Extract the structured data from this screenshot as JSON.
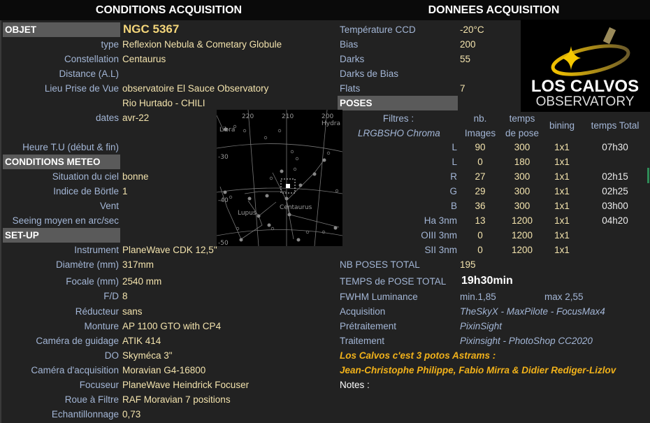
{
  "headers": {
    "left": "CONDITIONS ACQUISITION",
    "right": "DONNEES ACQUISITION"
  },
  "sections": {
    "objet": "OBJET",
    "meteo": "CONDITIONS METEO",
    "setup": "SET-UP",
    "poses": "POSES"
  },
  "object_name": "NGC 5367",
  "left_rows": [
    {
      "label": "type",
      "value": "Reflexion Nebula & Cometary Globule"
    },
    {
      "label": "Constellation",
      "value": "Centaurus"
    },
    {
      "label": "Distance (A.L)",
      "value": ""
    },
    {
      "label": "Lieu Prise de Vue",
      "value": "observatoire El Sauce Observatory"
    },
    {
      "label": "",
      "value": "Rio Hurtado - CHILI"
    },
    {
      "label": "dates",
      "value": "avr-22"
    },
    {
      "label": "Heure T.U (début & fin)",
      "value": ""
    },
    {
      "label": "Situation du ciel",
      "value": "bonne"
    },
    {
      "label": "Indice de Börtle",
      "value": "1"
    },
    {
      "label": "Vent",
      "value": ""
    },
    {
      "label": "Seeing moyen en arc/sec",
      "value": ""
    },
    {
      "label": "Instrument",
      "value": "PlaneWave CDK 12,5\""
    },
    {
      "label": "Diamètre (mm)",
      "value": "317mm"
    },
    {
      "label": "Focale (mm)",
      "value": "2540 mm"
    },
    {
      "label": "F/D",
      "value": "8"
    },
    {
      "label": "Réducteur",
      "value": "sans"
    },
    {
      "label": "Monture",
      "value": "AP 1100 GTO with CP4"
    },
    {
      "label": "Caméra de guidage",
      "value": "ATIK 414"
    },
    {
      "label": "DO",
      "value": "Skyméca 3\""
    },
    {
      "label": "Caméra d'acquisition",
      "value": "Moravian G4-16800"
    },
    {
      "label": "Focuseur",
      "value": "PlaneWave Heindrick Focuser"
    },
    {
      "label": "Roue à Filtre",
      "value": "RAF Moravian 7 positions"
    },
    {
      "label": "Echantillonnage",
      "value": "0,73"
    }
  ],
  "right_top": [
    {
      "label": "Température CCD",
      "value": "-20°C"
    },
    {
      "label": "Bias",
      "value": "200"
    },
    {
      "label": "Darks",
      "value": "55"
    },
    {
      "label": "Darks de Bias",
      "value": ""
    },
    {
      "label": "Flats",
      "value": "7"
    }
  ],
  "poses_table": {
    "filters_label": "Filtres :",
    "filters_name": "LRGBSHO Chroma",
    "col_nb": [
      "nb.",
      "Images"
    ],
    "col_temps": [
      "temps",
      "de pose"
    ],
    "col_bining": "bining",
    "col_total": "temps Total",
    "rows": [
      {
        "filter": "L",
        "nb": "90",
        "pose": "300",
        "bin": "1x1",
        "total": "07h30"
      },
      {
        "filter": "L",
        "nb": "0",
        "pose": "180",
        "bin": "1x1",
        "total": ""
      },
      {
        "filter": "R",
        "nb": "27",
        "pose": "300",
        "bin": "1x1",
        "total": "02h15"
      },
      {
        "filter": "G",
        "nb": "29",
        "pose": "300",
        "bin": "1x1",
        "total": "02h25"
      },
      {
        "filter": "B",
        "nb": "36",
        "pose": "300",
        "bin": "1x1",
        "total": "03h00"
      },
      {
        "filter": "Ha 3nm",
        "nb": "13",
        "pose": "1200",
        "bin": "1x1",
        "total": "04h20"
      },
      {
        "filter": "OIII 3nm",
        "nb": "0",
        "pose": "1200",
        "bin": "1x1",
        "total": ""
      },
      {
        "filter": "SII 3nm",
        "nb": "0",
        "pose": "1200",
        "bin": "1x1",
        "total": ""
      }
    ]
  },
  "totals": {
    "nb_label": "NB POSES TOTAL",
    "nb_value": "195",
    "temps_label": "TEMPS de POSE TOTAL",
    "temps_value": "19h30min",
    "fwhm_label": "FWHM Luminance",
    "fwhm_min": "min.1,85",
    "fwhm_max": "max 2,55"
  },
  "software": [
    {
      "label": "Acquisition",
      "value": "TheSkyX - MaxPilote - FocusMax4"
    },
    {
      "label": "Prétraitement",
      "value": "PixinSight"
    },
    {
      "label": "Traitement",
      "value": "Pixinsight - PhotoShop CC2020"
    }
  ],
  "credits": [
    "Los Calvos c'est 3 potos Astrams :",
    "Jean-Christophe Philippe, Fabio Mirra & Didier Rediger-Lizlov"
  ],
  "notes_label": "Notes :",
  "logo": {
    "line1": "LOS CALVOS",
    "line2": "OBSERVATORY"
  },
  "chart_labels": {
    "ra": [
      "220",
      "210",
      "200"
    ],
    "dec": [
      "-30",
      "-40",
      "-50"
    ],
    "constellations": [
      "Libra",
      "Hydra",
      "Centaurus",
      "Lupus"
    ]
  }
}
